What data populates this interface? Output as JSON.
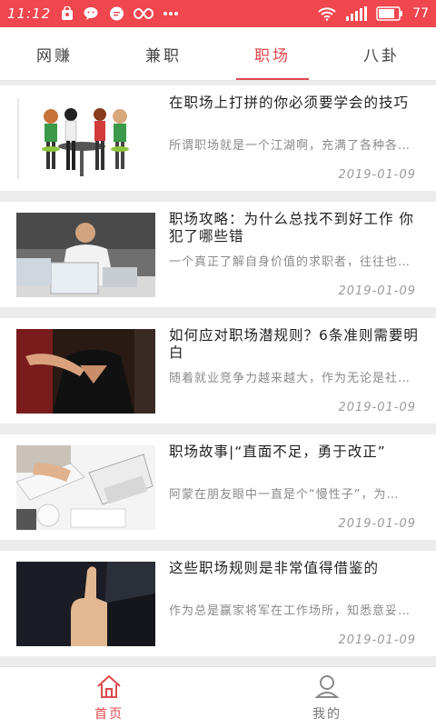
{
  "status_bar": {
    "time": "11:12",
    "battery": "77",
    "colors": {
      "background": "#f0464e",
      "foreground": "#ffffff"
    },
    "icons_left": [
      "shop-bag-icon",
      "wechat-icon",
      "message-icon",
      "infinity-icon",
      "more-dots-icon"
    ],
    "icons_right": [
      "wifi-icon",
      "signal-icon",
      "battery-icon"
    ]
  },
  "tabs": [
    {
      "label": "网赚",
      "active": false
    },
    {
      "label": "兼职",
      "active": false
    },
    {
      "label": "职场",
      "active": true
    },
    {
      "label": "八卦",
      "active": false
    }
  ],
  "accent_color": "#e0484e",
  "articles": [
    {
      "title": "在职场上打拼的你必须要学会的技巧",
      "summary": "所谓职场就是一个江湖啊，充满了各种各…",
      "date": "2019-01-09",
      "thumbnail": "women-at-table-illustration"
    },
    {
      "title": "职场攻略：为什么总找不到好工作 你犯了哪些错",
      "summary": "一个真正了解自身价值的求职者，往往也…",
      "date": "2019-01-09",
      "thumbnail": "stressed-man-laptop-photo"
    },
    {
      "title": "如何应对职场潜规则？6条准则需要明白",
      "summary": "随着就业竞争力越来越大，作为无论是社…",
      "date": "2019-01-09",
      "thumbnail": "hand-on-shoulder-photo"
    },
    {
      "title": "职场故事|“直面不足，勇于改正”",
      "summary": "阿蒙在朋友眼中一直是个“慢性子”，为…",
      "date": "2019-01-09",
      "thumbnail": "writing-at-desk-photo"
    },
    {
      "title": "这些职场规则是非常值得借鉴的",
      "summary": "作为总是赢家将军在工作场所，知悉意妥…",
      "date": "2019-01-09",
      "thumbnail": "thumbs-up-photo"
    }
  ],
  "bottom_nav": [
    {
      "label": "首页",
      "icon": "home-icon",
      "active": true
    },
    {
      "label": "我的",
      "icon": "user-icon",
      "active": false
    }
  ]
}
